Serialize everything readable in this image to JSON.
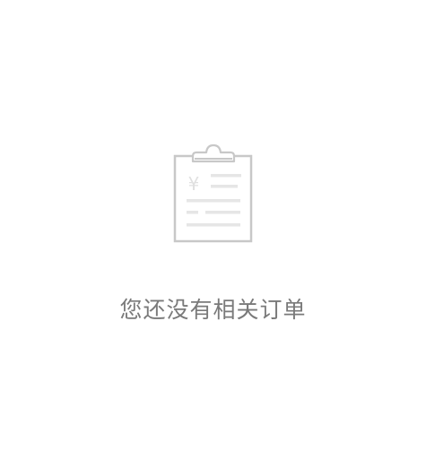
{
  "empty_state": {
    "icon": "clipboard-order-icon",
    "currency_symbol": "¥",
    "message": "您还没有相关订单"
  },
  "colors": {
    "background": "#ffffff",
    "icon_stroke": "#c8c8c8",
    "icon_line": "#e6e6e6",
    "text": "#7a7a7a"
  }
}
